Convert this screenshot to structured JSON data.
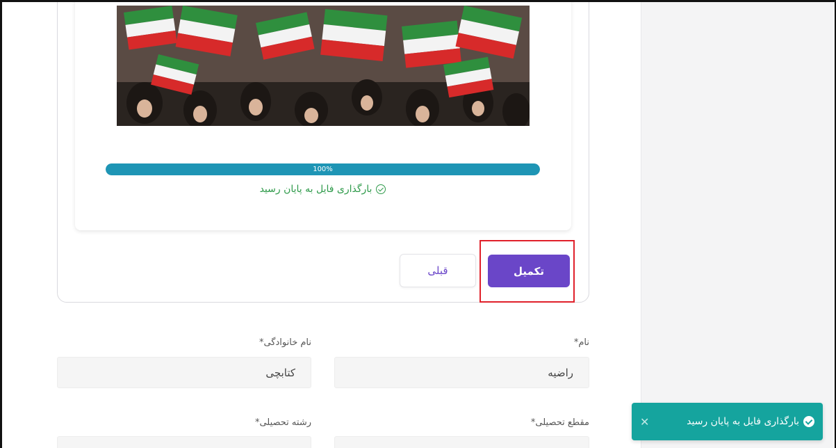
{
  "upload": {
    "progress_percent": 100,
    "progress_label": "100%",
    "status_text": "بارگذاری فایل به پایان رسید",
    "status_icon": "check-circle-icon",
    "status_color": "#2e9a4a",
    "progress_color": "#1e95b5"
  },
  "actions": {
    "prev_label": "قبلی",
    "finish_label": "تکمیل",
    "finish_color": "#6a46c8"
  },
  "form": {
    "first_name": {
      "label": "نام*",
      "value": "راضیه"
    },
    "last_name": {
      "label": "نام خانوادگی*",
      "value": "کتابچی"
    },
    "education_level": {
      "label": "مقطع تحصیلی*"
    },
    "field_of_study": {
      "label": "رشته تحصیلی*"
    }
  },
  "toast": {
    "text": "بارگذاری فایل به پایان رسید",
    "icon": "check-circle-icon",
    "close_icon": "close-icon",
    "color": "#15a49e"
  }
}
